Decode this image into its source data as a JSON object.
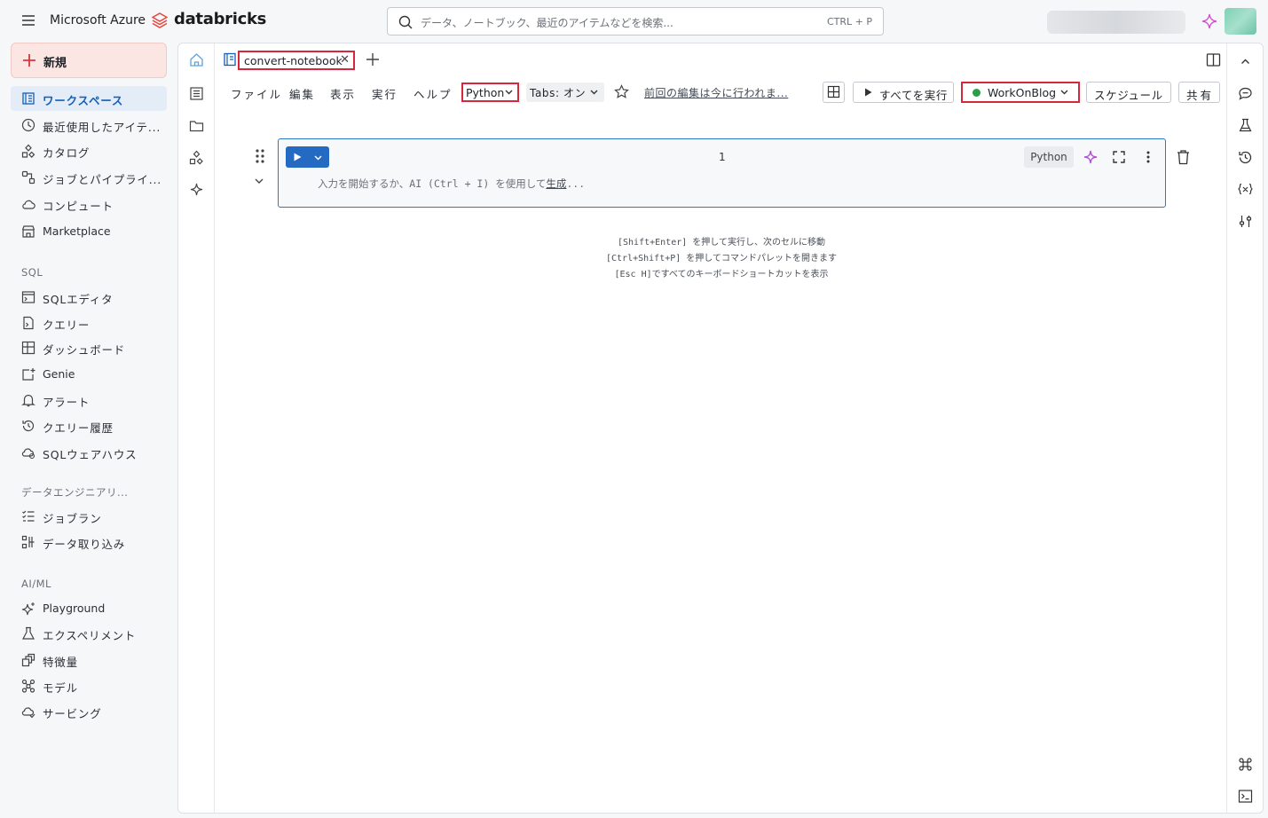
{
  "topbar": {
    "platform": "Microsoft Azure",
    "brand": "databricks",
    "search_placeholder": "データ、ノートブック、最近のアイテムなどを検索...",
    "search_shortcut": "CTRL + P"
  },
  "sidebar": {
    "new_label": "新規",
    "items": [
      {
        "label": "ワークスペース",
        "icon": "workspace-icon",
        "active": true
      },
      {
        "label": "最近使用したアイテ...",
        "icon": "clock-icon"
      },
      {
        "label": "カタログ",
        "icon": "catalog-icon"
      },
      {
        "label": "ジョブとパイプライ...",
        "icon": "jobs-icon"
      },
      {
        "label": "コンピュート",
        "icon": "cloud-icon"
      },
      {
        "label": "Marketplace",
        "icon": "store-icon"
      }
    ],
    "sql_section": "SQL",
    "sql_items": [
      {
        "label": "SQLエディタ",
        "icon": "sql-editor-icon"
      },
      {
        "label": "クエリー",
        "icon": "query-icon"
      },
      {
        "label": "ダッシュボード",
        "icon": "dashboard-icon"
      },
      {
        "label": "Genie",
        "icon": "genie-icon"
      },
      {
        "label": "アラート",
        "icon": "bell-icon"
      },
      {
        "label": "クエリー履歴",
        "icon": "history-icon"
      },
      {
        "label": "SQLウェアハウス",
        "icon": "warehouse-icon"
      }
    ],
    "de_section": "データエンジニアリ...",
    "de_items": [
      {
        "label": "ジョブラン",
        "icon": "job-runs-icon"
      },
      {
        "label": "データ取り込み",
        "icon": "ingest-icon"
      }
    ],
    "ml_section": "AI/ML",
    "ml_items": [
      {
        "label": "Playground",
        "icon": "sparkle-icon"
      },
      {
        "label": "エクスペリメント",
        "icon": "flask-icon"
      },
      {
        "label": "特徴量",
        "icon": "features-icon"
      },
      {
        "label": "モデル",
        "icon": "model-icon"
      },
      {
        "label": "サービング",
        "icon": "serving-icon"
      }
    ]
  },
  "notebook": {
    "tab_name": "convert-notebook",
    "menus": [
      "ファイル",
      "編集",
      "表示",
      "実行",
      "ヘルプ"
    ],
    "language": "Python",
    "tabs_setting": "Tabs: オン",
    "last_edit": "前回の編集は今に行われま...",
    "run_all": "すべてを実行",
    "cluster": "WorkOnBlog",
    "cluster_status_color": "#2e9d4a",
    "schedule": "スケジュール",
    "share": "共有"
  },
  "cell": {
    "number": "1",
    "language": "Python",
    "placeholder_prefix": "入力を開始するか、AI (Ctrl + I) を使用して",
    "placeholder_link": "生成",
    "placeholder_suffix": "..."
  },
  "hints": [
    "[Shift+Enter] を押して実行し、次のセルに移動",
    "[Ctrl+Shift+P] を押してコマンドパレットを開きます",
    "[Esc H]ですべてのキーボードショートカットを表示"
  ],
  "colors": {
    "accent": "#2469c2",
    "highlight_border": "#d7263d",
    "new_button_bg": "#fbe6e4"
  }
}
